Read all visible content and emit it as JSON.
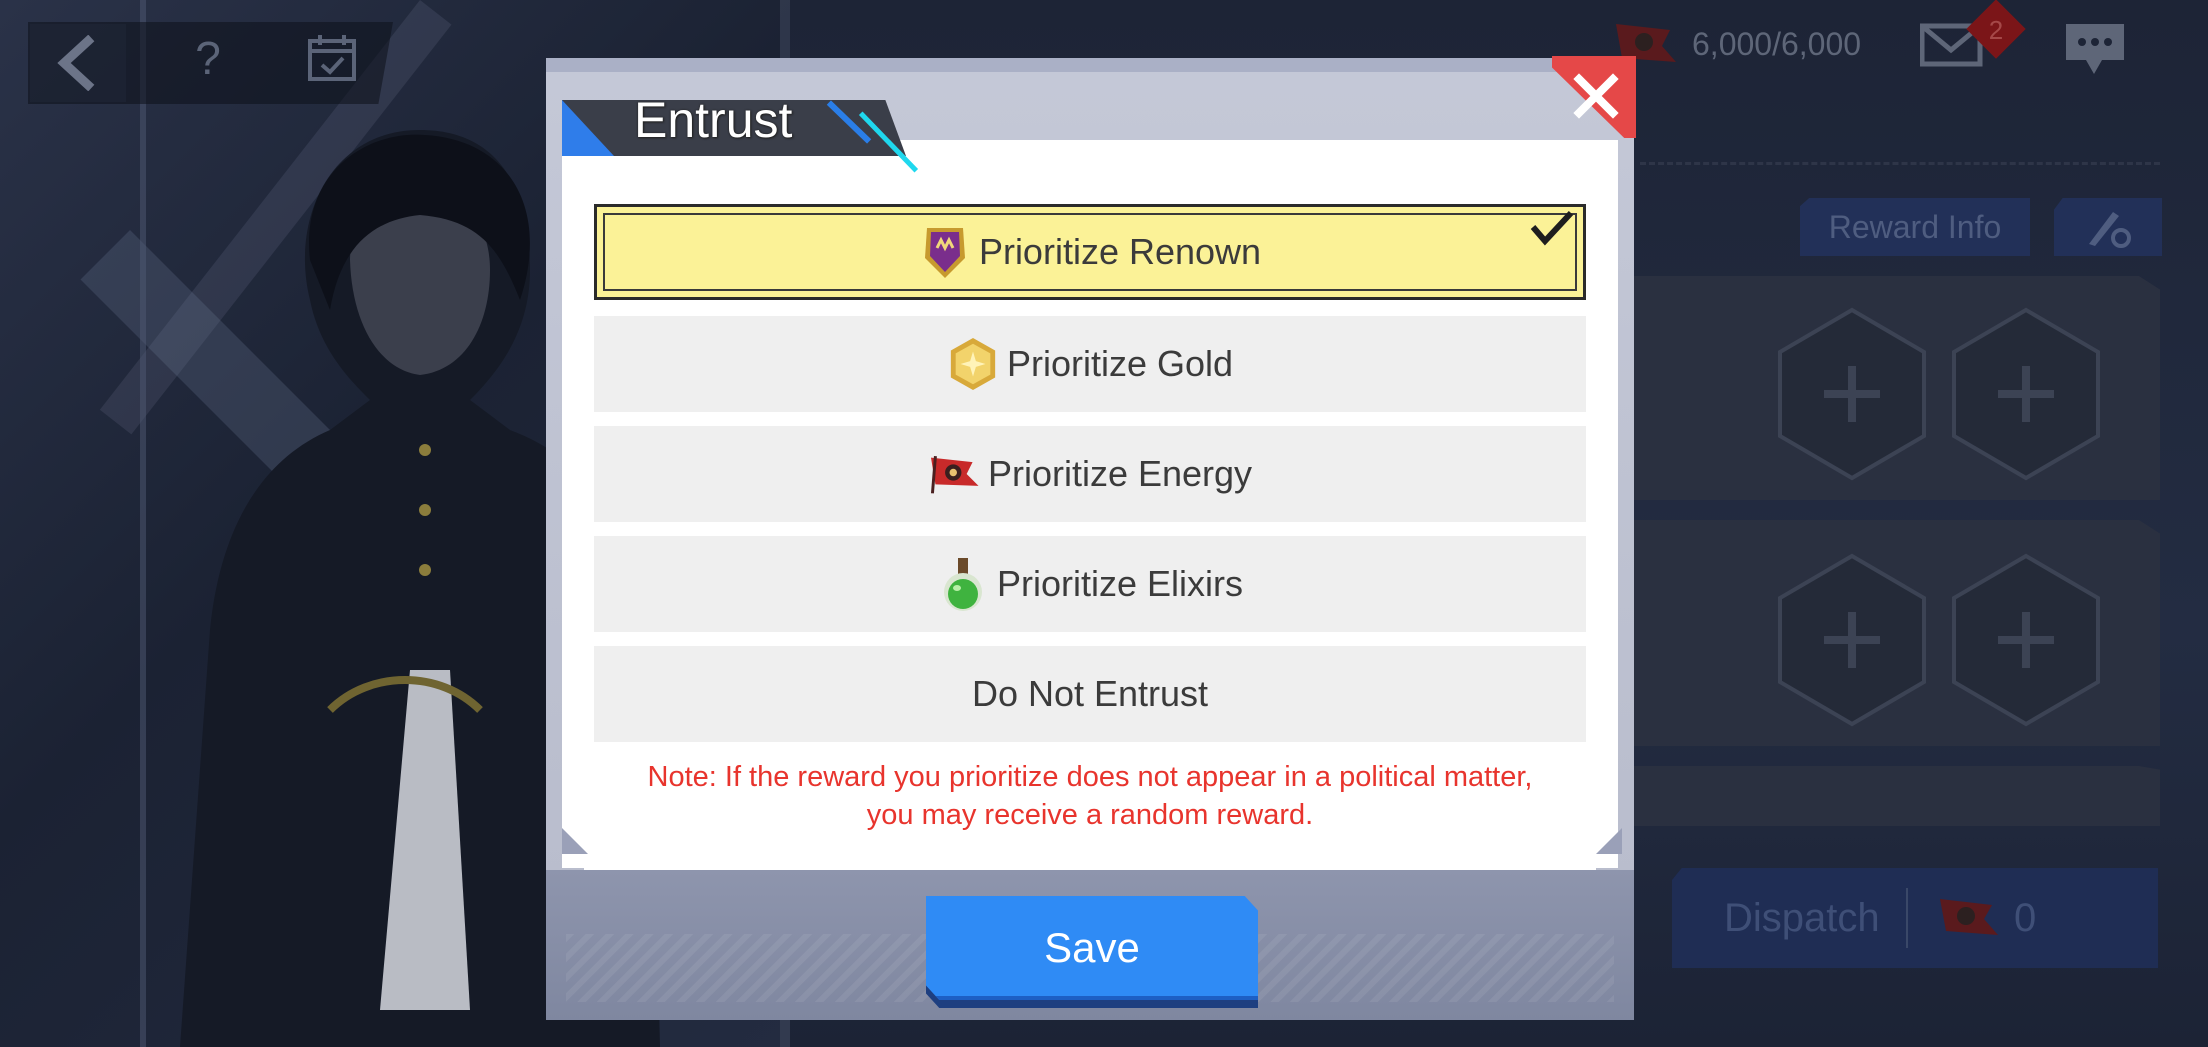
{
  "header": {
    "energy_value": "6,000/6,000",
    "mail_badge": "2",
    "help_label": "?"
  },
  "side": {
    "reward_info_label": "Reward Info",
    "dispatch_label": "Dispatch",
    "dispatch_count": "0"
  },
  "dialog": {
    "title": "Entrust",
    "options": [
      {
        "label": "Prioritize Renown",
        "icon": "renown-badge-icon",
        "selected": true
      },
      {
        "label": "Prioritize Gold",
        "icon": "gold-coin-icon",
        "selected": false
      },
      {
        "label": "Prioritize Energy",
        "icon": "energy-flag-icon",
        "selected": false
      },
      {
        "label": "Prioritize Elixirs",
        "icon": "elixir-potion-icon",
        "selected": false
      },
      {
        "label": "Do Not Entrust",
        "icon": "",
        "selected": false
      }
    ],
    "note_line1": "Note: If the reward you prioritize does not appear in a political matter,",
    "note_line2": "you may receive a random reward.",
    "save_label": "Save"
  },
  "colors": {
    "accent_blue": "#2f8bf5",
    "selected_yellow": "#fbf297",
    "note_red": "#e8342d",
    "close_red": "#e54848"
  }
}
